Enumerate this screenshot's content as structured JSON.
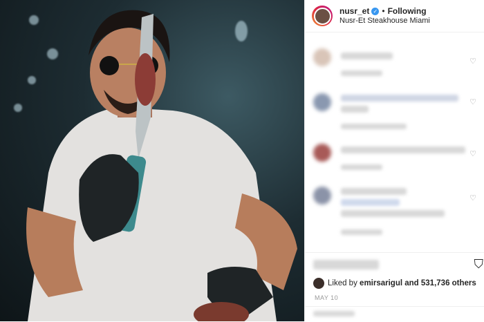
{
  "post": {
    "username": "nusr_et",
    "follow_status": "Following",
    "location": "Nusr-Et Steakhouse Miami",
    "liked_by_prefix": "Liked by",
    "liked_by_user": "emirsarigul",
    "liked_by_suffix": "and 531,736 others",
    "date": "MAY 10"
  },
  "icons": {
    "verified": "verified-badge-icon",
    "heart": "heart-icon",
    "save": "bookmark-icon"
  },
  "colors": {
    "verified_blue": "#3897f0",
    "text": "#262626",
    "muted": "#8e8e8e"
  }
}
